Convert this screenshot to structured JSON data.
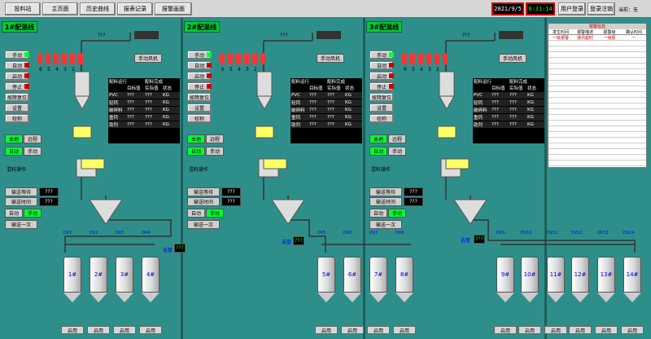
{
  "nav": {
    "items": [
      "投料站",
      "主页面",
      "历史曲线",
      "报表记录",
      "报警画面"
    ]
  },
  "clock": {
    "date": "2021/9/5",
    "time": "8:31:14"
  },
  "user": {
    "login": "用户登录",
    "logout": "登录注销",
    "current": "当前：无"
  },
  "lines": [
    {
      "title": "1#配混线",
      "bins": [
        "1#",
        "2#",
        "3#",
        "4#"
      ],
      "dv": [
        "DV1",
        "DV2",
        "DV3",
        "DV4"
      ]
    },
    {
      "title": "2#配混线",
      "bins": [
        "5#",
        "6#",
        "7#",
        "8#"
      ],
      "dv": [
        "DV5",
        "DV6",
        "DV7",
        "DV8"
      ]
    },
    {
      "title": "3#配混线",
      "bins": [
        "9#",
        "10#",
        "11#",
        "12#",
        "13#",
        "14#"
      ],
      "dv": [
        "DV9",
        "DV10",
        "DV11",
        "DV12",
        "DV13",
        "DV14"
      ]
    }
  ],
  "controls": {
    "manual": "手动",
    "auto": "自动",
    "start": "启动",
    "stop": "停止",
    "reset": "故障复位",
    "setup": "设置",
    "calib": "校称",
    "local": "本地",
    "remote": "远程",
    "mix_op": "混料操作",
    "wait": "输送等待",
    "time": "输送时间",
    "convey_once": "输送一次",
    "fan": "手动风机",
    "query": "???",
    "alarm_lbl": "选管",
    "start_bin": "启用",
    "scale_numbers": [
      "6",
      "5",
      "4",
      "3",
      "2",
      "1"
    ]
  },
  "table": {
    "header": [
      "配料运行",
      "配料完成"
    ],
    "cols": [
      "目标值",
      "实际值",
      "状态"
    ],
    "rows": [
      "PVC",
      "轻钙",
      "破碎料",
      "重钙",
      "助剂"
    ],
    "unit": "KG"
  },
  "alarm": {
    "title": "报警信息",
    "cols": [
      "发生时间",
      "报警描述",
      "报警级",
      "确认时间"
    ],
    "row1": [
      "一级报警",
      "通讯超时",
      "一级报",
      "—"
    ]
  }
}
